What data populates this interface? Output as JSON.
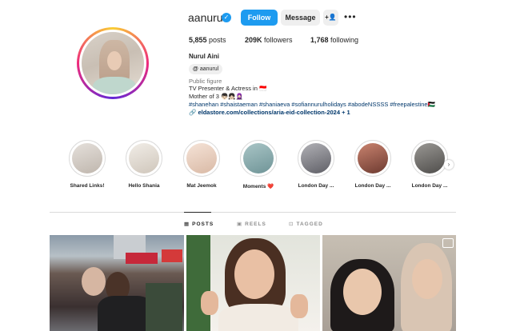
{
  "profile": {
    "username": "aanurul",
    "verified_icon": "verified-badge-icon",
    "follow_label": "Follow",
    "message_label": "Message",
    "suggest_icon": "add-person-icon",
    "more_icon": "more-horizontal-icon",
    "stats": {
      "posts_count": "5,855",
      "posts_label": "posts",
      "followers_count": "209K",
      "followers_label": "followers",
      "following_count": "1,768",
      "following_label": "following"
    },
    "full_name": "Nurul Aini",
    "threads_handle": "aanurul",
    "category": "Public figure",
    "bio": [
      "TV Presenter & Actress in 🇮🇩",
      "Mother of 3 👦🏻👧🏻🧕🏻"
    ],
    "hashtags": "#shanehan #shaistaeman #shaniaeva #sofiannurulholidays #abodeNSSSS #freepalestine🇵🇸",
    "link": "eldastore.com/collections/aria-eid-collection-2024 + 1"
  },
  "highlights": [
    {
      "label": "Shared Links!",
      "color": "#d9d4cf"
    },
    {
      "label": "Hello Shania",
      "color": "#e8e2da"
    },
    {
      "label": "Mat Jeemok",
      "color": "#f1d9c9"
    },
    {
      "label": "Moments ❤️",
      "color": "#8fb2b5"
    },
    {
      "label": "London Day ...",
      "color": "#8a8a8f"
    },
    {
      "label": "London Day ...",
      "color": "#a05a4a"
    },
    {
      "label": "London Day ...",
      "color": "#6f6d6a"
    }
  ],
  "tabs": [
    {
      "label": "POSTS",
      "icon": "grid-icon",
      "active": true
    },
    {
      "label": "REELS",
      "icon": "reels-icon",
      "active": false
    },
    {
      "label": "TAGGED",
      "icon": "tagged-icon",
      "active": false
    }
  ]
}
